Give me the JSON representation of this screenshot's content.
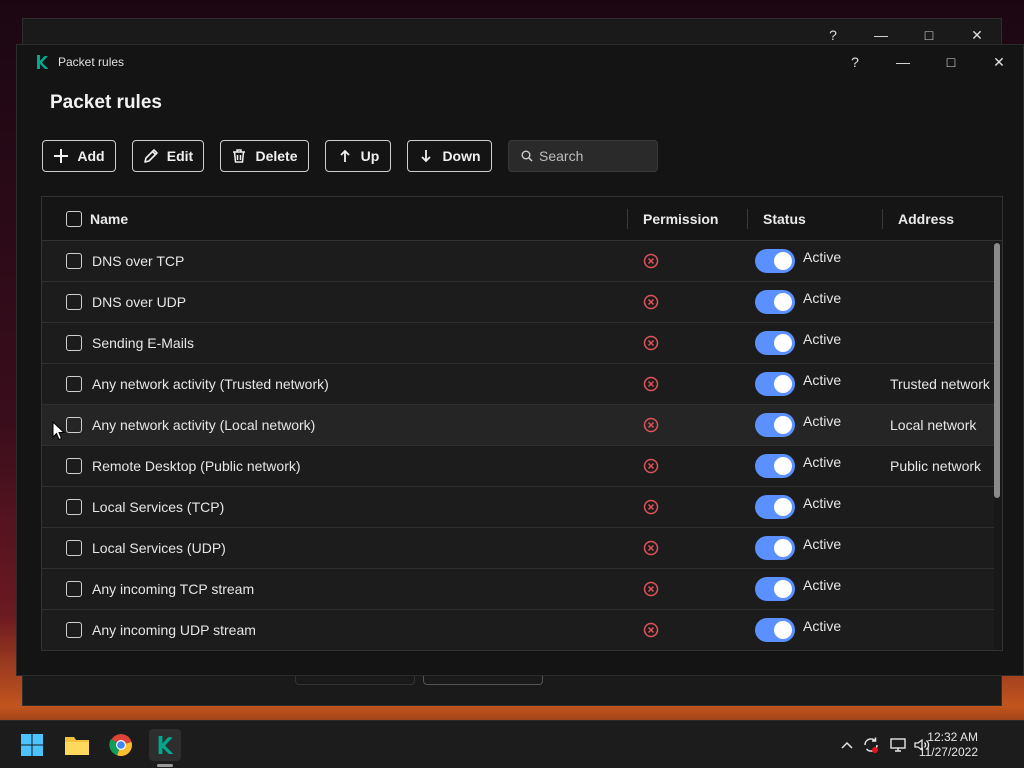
{
  "background_window": {
    "controls": [
      "?",
      "—",
      "□",
      "✕"
    ]
  },
  "window": {
    "title": "Packet rules",
    "controls": {
      "help": "?",
      "minimize": "—",
      "maximize": "□",
      "close": "✕"
    }
  },
  "page": {
    "heading": "Packet rules"
  },
  "toolbar": {
    "add": "Add",
    "edit": "Edit",
    "delete": "Delete",
    "up": "Up",
    "down": "Down",
    "search_placeholder": "Search"
  },
  "table": {
    "columns": {
      "name": "Name",
      "permission": "Permission",
      "status": "Status",
      "address": "Address"
    },
    "rows": [
      {
        "name": "DNS over TCP",
        "permission": "blocked",
        "status": "Active",
        "address": "",
        "enabled": true
      },
      {
        "name": "DNS over UDP",
        "permission": "blocked",
        "status": "Active",
        "address": "",
        "enabled": true
      },
      {
        "name": "Sending E-Mails",
        "permission": "blocked",
        "status": "Active",
        "address": "",
        "enabled": true
      },
      {
        "name": "Any network activity (Trusted network)",
        "permission": "blocked",
        "status": "Active",
        "address": "Trusted network",
        "enabled": true
      },
      {
        "name": "Any network activity (Local network)",
        "permission": "blocked",
        "status": "Active",
        "address": "Local network",
        "enabled": true
      },
      {
        "name": "Remote Desktop (Public network)",
        "permission": "blocked",
        "status": "Active",
        "address": "Public network",
        "enabled": true
      },
      {
        "name": "Local Services (TCP)",
        "permission": "blocked",
        "status": "Active",
        "address": "",
        "enabled": true
      },
      {
        "name": "Local Services (UDP)",
        "permission": "blocked",
        "status": "Active",
        "address": "",
        "enabled": true
      },
      {
        "name": "Any incoming TCP stream",
        "permission": "blocked",
        "status": "Active",
        "address": "",
        "enabled": true
      },
      {
        "name": "Any incoming UDP stream",
        "permission": "blocked",
        "status": "Active",
        "address": "",
        "enabled": true
      }
    ]
  },
  "taskbar": {
    "apps": [
      "windows-start-icon",
      "file-explorer-icon",
      "chrome-icon",
      "kaspersky-icon"
    ],
    "tray": {
      "overflow": "^"
    },
    "clock": {
      "time": "12:32 AM",
      "date": "11/27/2022"
    }
  },
  "colors": {
    "accent": "#5a90ff",
    "blocked": "#e0525a",
    "brand": "#00a88e",
    "window_bg": "#141414"
  }
}
